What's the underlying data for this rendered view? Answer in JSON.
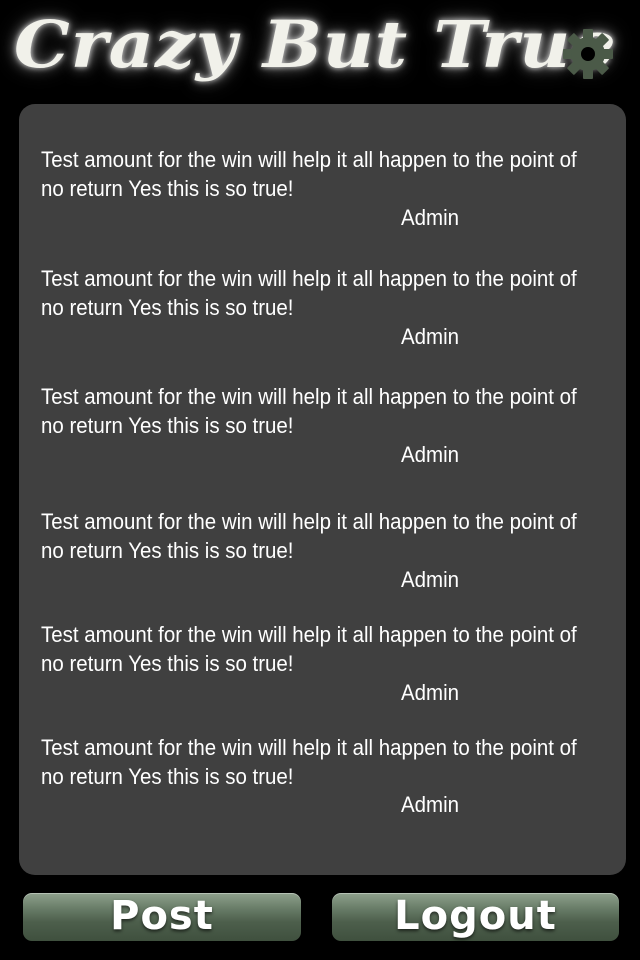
{
  "header": {
    "title": "Crazy But True",
    "settings_icon": "gear-icon"
  },
  "feed": {
    "items": [
      {
        "text": "Test amount for the win will help it all happen to the point of no return Yes this is so true!",
        "author": "Admin"
      },
      {
        "text": "Test amount for the win will help it all happen to the point of no return Yes this is so true!",
        "author": "Admin"
      },
      {
        "text": "Test amount for the win will help it all happen to the point of no return Yes this is so true!",
        "author": "Admin"
      },
      {
        "text": "Test amount for the win will help it all happen to the point of no return Yes this is so true!",
        "author": "Admin"
      },
      {
        "text": "Test amount for the win will help it all happen to the point of no return Yes this is so true!",
        "author": "Admin"
      },
      {
        "text": "Test amount for the win will help it all happen to the point of no return Yes this is so true!",
        "author": "Admin"
      }
    ]
  },
  "actions": {
    "post_label": "Post",
    "logout_label": "Logout"
  },
  "colors": {
    "background": "#000000",
    "panel": "#404040",
    "button_green": "#5e705d",
    "gear": "#4b5a48"
  }
}
